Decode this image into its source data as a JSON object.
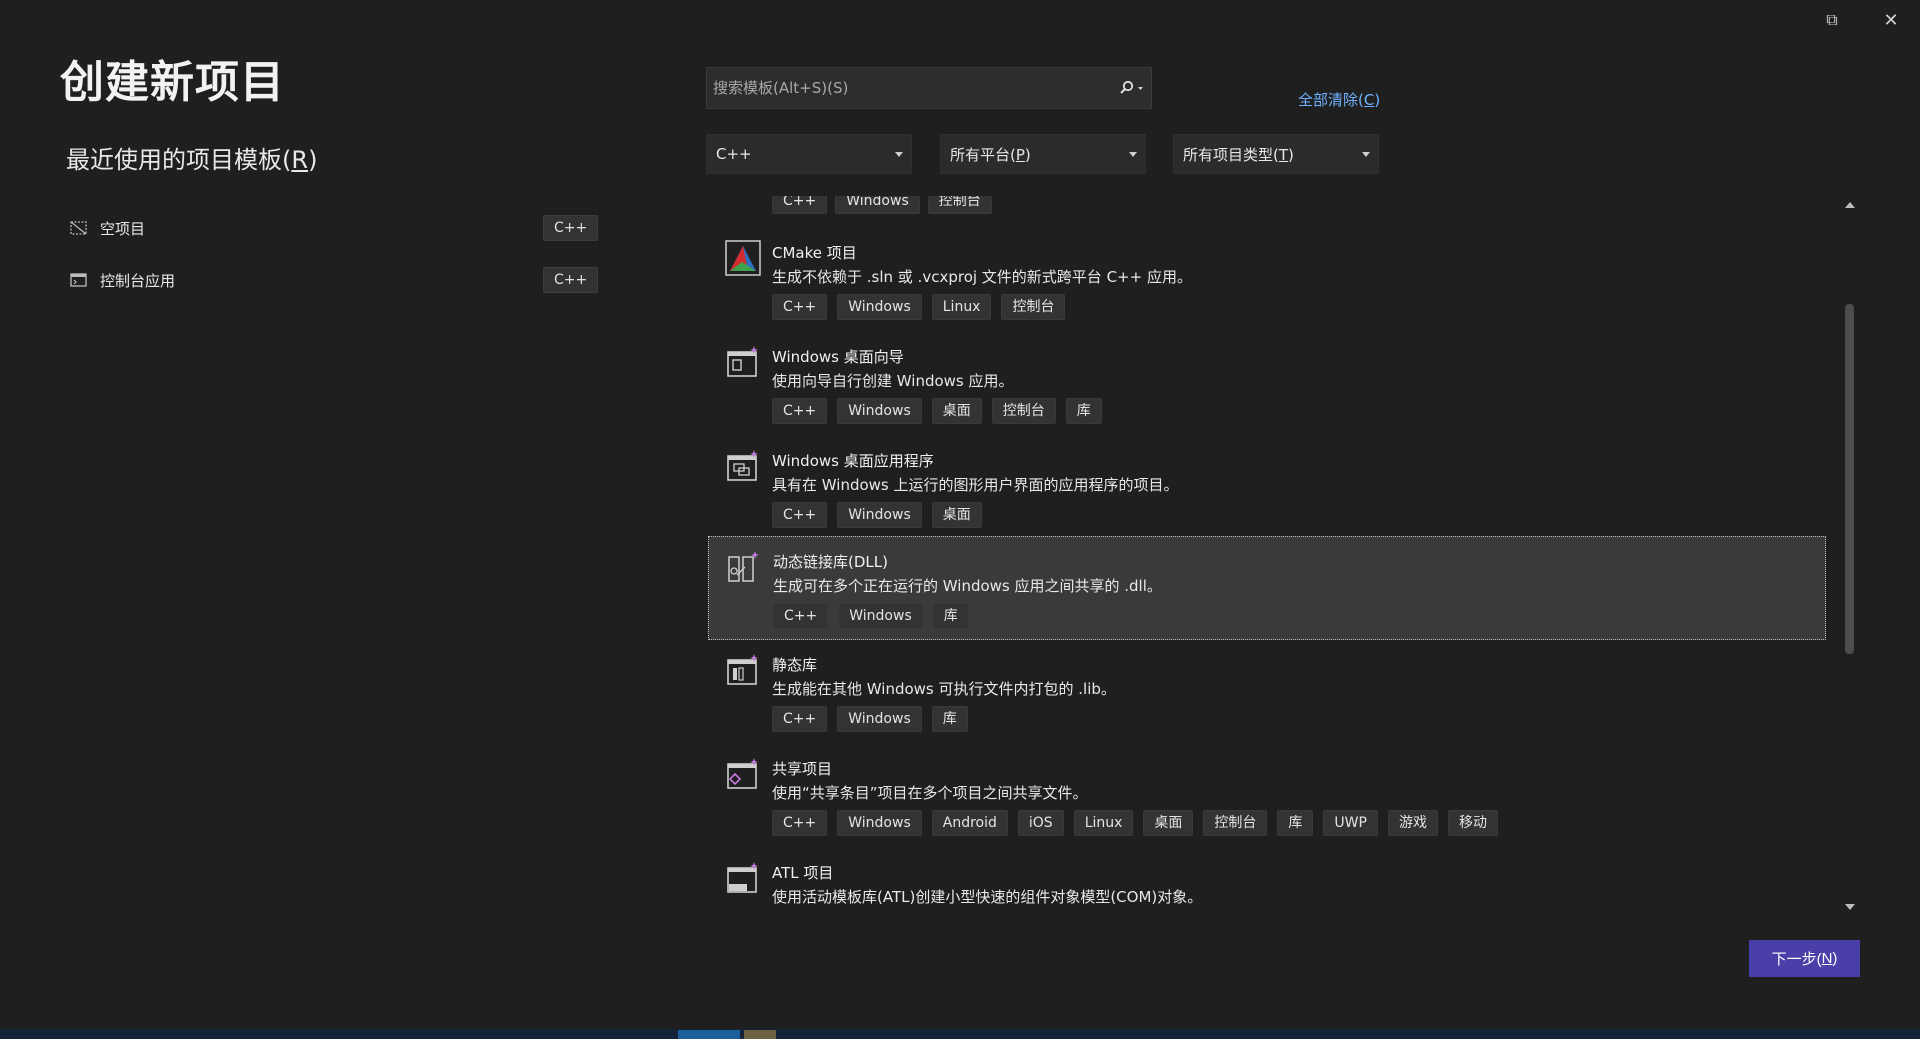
{
  "window_controls": {
    "restore_glyph": "⧉",
    "close_glyph": "✕"
  },
  "header": {
    "title": "创建新项目"
  },
  "recent": {
    "title_prefix": "最近使用的项目模板(",
    "title_key": "R",
    "title_suffix": ")",
    "items": [
      {
        "label": "空项目",
        "tag": "C++",
        "icon": "empty-project-icon"
      },
      {
        "label": "控制台应用",
        "tag": "C++",
        "icon": "console-app-icon"
      }
    ]
  },
  "search": {
    "placeholder": "搜索模板(Alt+S)(S)",
    "value": "",
    "icon": "search-icon"
  },
  "clear_all": {
    "prefix": "全部清除(",
    "key": "C",
    "suffix": ")"
  },
  "filters": {
    "language": {
      "value": "C++"
    },
    "platform": {
      "prefix": "所有平台(",
      "key": "P",
      "suffix": ")"
    },
    "project_type": {
      "prefix": "所有项目类型(",
      "key": "T",
      "suffix": ")"
    }
  },
  "templates": {
    "partial_top_tags": [
      "C++",
      "Windows",
      "控制台"
    ],
    "items": [
      {
        "name": "CMake 项目",
        "description": "生成不依赖于 .sln 或 .vcxproj 文件的新式跨平台 C++ 应用。",
        "tags": [
          "C++",
          "Windows",
          "Linux",
          "控制台"
        ],
        "icon": "cmake-icon"
      },
      {
        "name": "Windows 桌面向导",
        "description": "使用向导自行创建 Windows 应用。",
        "tags": [
          "C++",
          "Windows",
          "桌面",
          "控制台",
          "库"
        ],
        "icon": "desktop-wizard-icon"
      },
      {
        "name": "Windows 桌面应用程序",
        "description": "具有在 Windows 上运行的图形用户界面的应用程序的项目。",
        "tags": [
          "C++",
          "Windows",
          "桌面"
        ],
        "icon": "desktop-app-icon"
      },
      {
        "name": "动态链接库(DLL)",
        "description": "生成可在多个正在运行的 Windows 应用之间共享的 .dll。",
        "tags": [
          "C++",
          "Windows",
          "库"
        ],
        "icon": "dll-icon",
        "selected": true
      },
      {
        "name": "静态库",
        "description": "生成能在其他 Windows 可执行文件内打包的 .lib。",
        "tags": [
          "C++",
          "Windows",
          "库"
        ],
        "icon": "static-lib-icon"
      },
      {
        "name": "共享项目",
        "description": "使用“共享条目”项目在多个项目之间共享文件。",
        "tags": [
          "C++",
          "Windows",
          "Android",
          "iOS",
          "Linux",
          "桌面",
          "控制台",
          "库",
          "UWP",
          "游戏",
          "移动"
        ],
        "icon": "shared-project-icon"
      },
      {
        "name": "ATL 项目",
        "description": "使用活动模板库(ATL)创建小型快速的组件对象模型(COM)对象。",
        "tags": [],
        "icon": "atl-project-icon"
      }
    ]
  },
  "next_button": {
    "prefix": "下一步(",
    "key": "N",
    "suffix": ")"
  },
  "colors": {
    "background": "#1f1f1f",
    "accent_button": "#4a3ea8",
    "link": "#6fb3ff",
    "selected_item": "#3a3a3a"
  }
}
